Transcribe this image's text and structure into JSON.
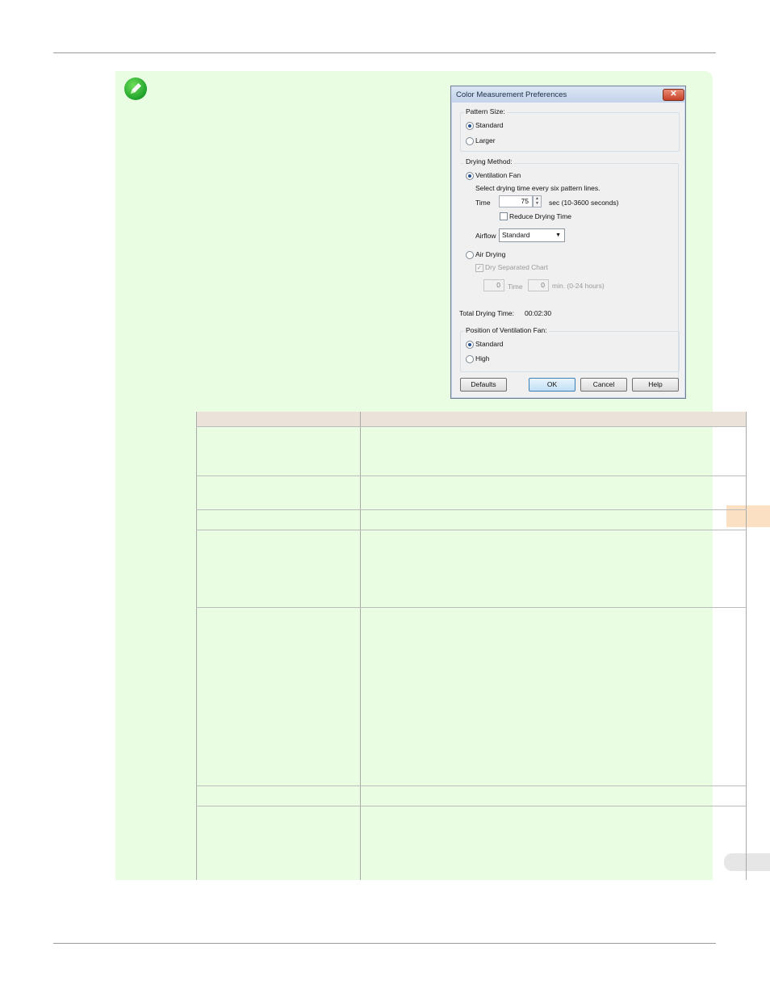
{
  "dialog": {
    "title": "Color Measurement Preferences",
    "close_glyph": "✕",
    "pattern_size": {
      "label": "Pattern Size:",
      "options": [
        "Standard",
        "Larger"
      ],
      "selected": "Standard"
    },
    "drying_method": {
      "label": "Drying Method:",
      "ventilation_fan_label": "Ventilation Fan",
      "hint": "Select drying time every six pattern lines.",
      "time_label": "Time",
      "time_value": "75",
      "time_unit": "sec (10-3600 seconds)",
      "reduce_label": "Reduce Drying Time",
      "airflow_label": "Airflow",
      "airflow_value": "Standard",
      "air_drying_label": "Air Drying",
      "dry_separated_label": "Dry Separated Chart",
      "air_time_hours": "0",
      "air_time_label": "Time",
      "air_time_minutes": "0",
      "air_time_unit": "min. (0-24 hours)"
    },
    "total_drying_label": "Total Drying Time:",
    "total_drying_value": "00:02:30",
    "fan_position": {
      "label": "Position of Ventilation Fan:",
      "options": [
        "Standard",
        "High"
      ],
      "selected": "Standard"
    },
    "buttons": {
      "defaults": "Defaults",
      "ok": "OK",
      "cancel": "Cancel",
      "help": "Help"
    }
  },
  "colors": {
    "note_background": "#e8fde2",
    "table_header": "#ebe3da",
    "side_tab": "#fbe0c4"
  },
  "icons": {
    "note": "pencil-note-icon"
  }
}
